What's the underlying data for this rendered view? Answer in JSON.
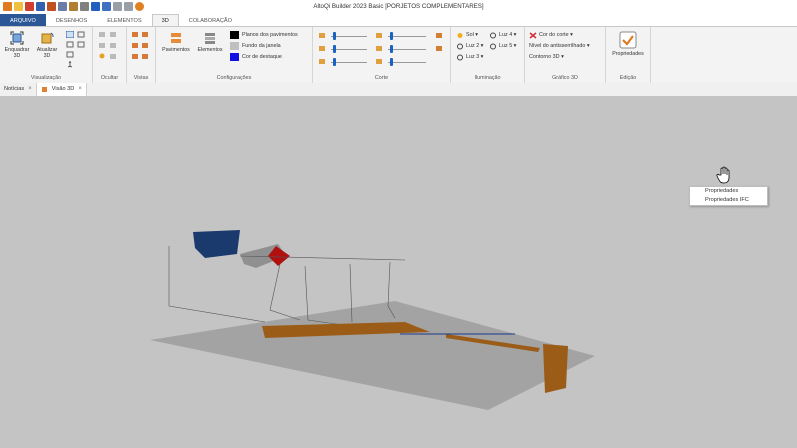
{
  "window": {
    "title": "AltoQi Builder 2023 Basic [PORJETOS COMPLEMENTARES]"
  },
  "ribbon_tabs": [
    "ARQUIVO",
    "DESENHOS",
    "ELEMENTOS",
    "3D",
    "COLABORAÇÃO"
  ],
  "groups": {
    "visualizacao": {
      "label": "Visualização",
      "enquadrar": "Enquadrar 3D",
      "atualizar": "Atualizar 3D"
    },
    "ocultar": {
      "label": "Ocultar"
    },
    "vistas": {
      "label": "Vistas"
    },
    "configuracoes": {
      "label": "Configurações",
      "pavimentos": "Pavimentos",
      "elementos": "Elementos",
      "planos": "Planos dos pavimentos",
      "fundo": "Fundo da janela",
      "destaque": "Cor de destaque"
    },
    "corte": {
      "label": "Corte"
    },
    "iluminacao": {
      "label": "Iluminação",
      "sol": "Sol",
      "luz2": "Luz 2",
      "luz3": "Luz 3",
      "luz4": "Luz 4",
      "luz5": "Luz 5"
    },
    "grafico3d": {
      "label": "Gráfico 3D",
      "cor_corte": "Cor do corte",
      "antisserrilhado": "Nível do antisserrilhado",
      "contorno": "Contorno 3D"
    },
    "edicao": {
      "label": "Edição",
      "propriedades": "Propriedades"
    }
  },
  "doc_tabs": [
    {
      "label": "Notícias"
    },
    {
      "label": "Visão 3D"
    }
  ],
  "context_menu": [
    "Propriedades",
    "Propriedades IFC"
  ],
  "colors": {
    "accent": "#2b5797",
    "planos": "#000000",
    "fundo": "#c0c0c0",
    "destaque": "#1010e0"
  }
}
